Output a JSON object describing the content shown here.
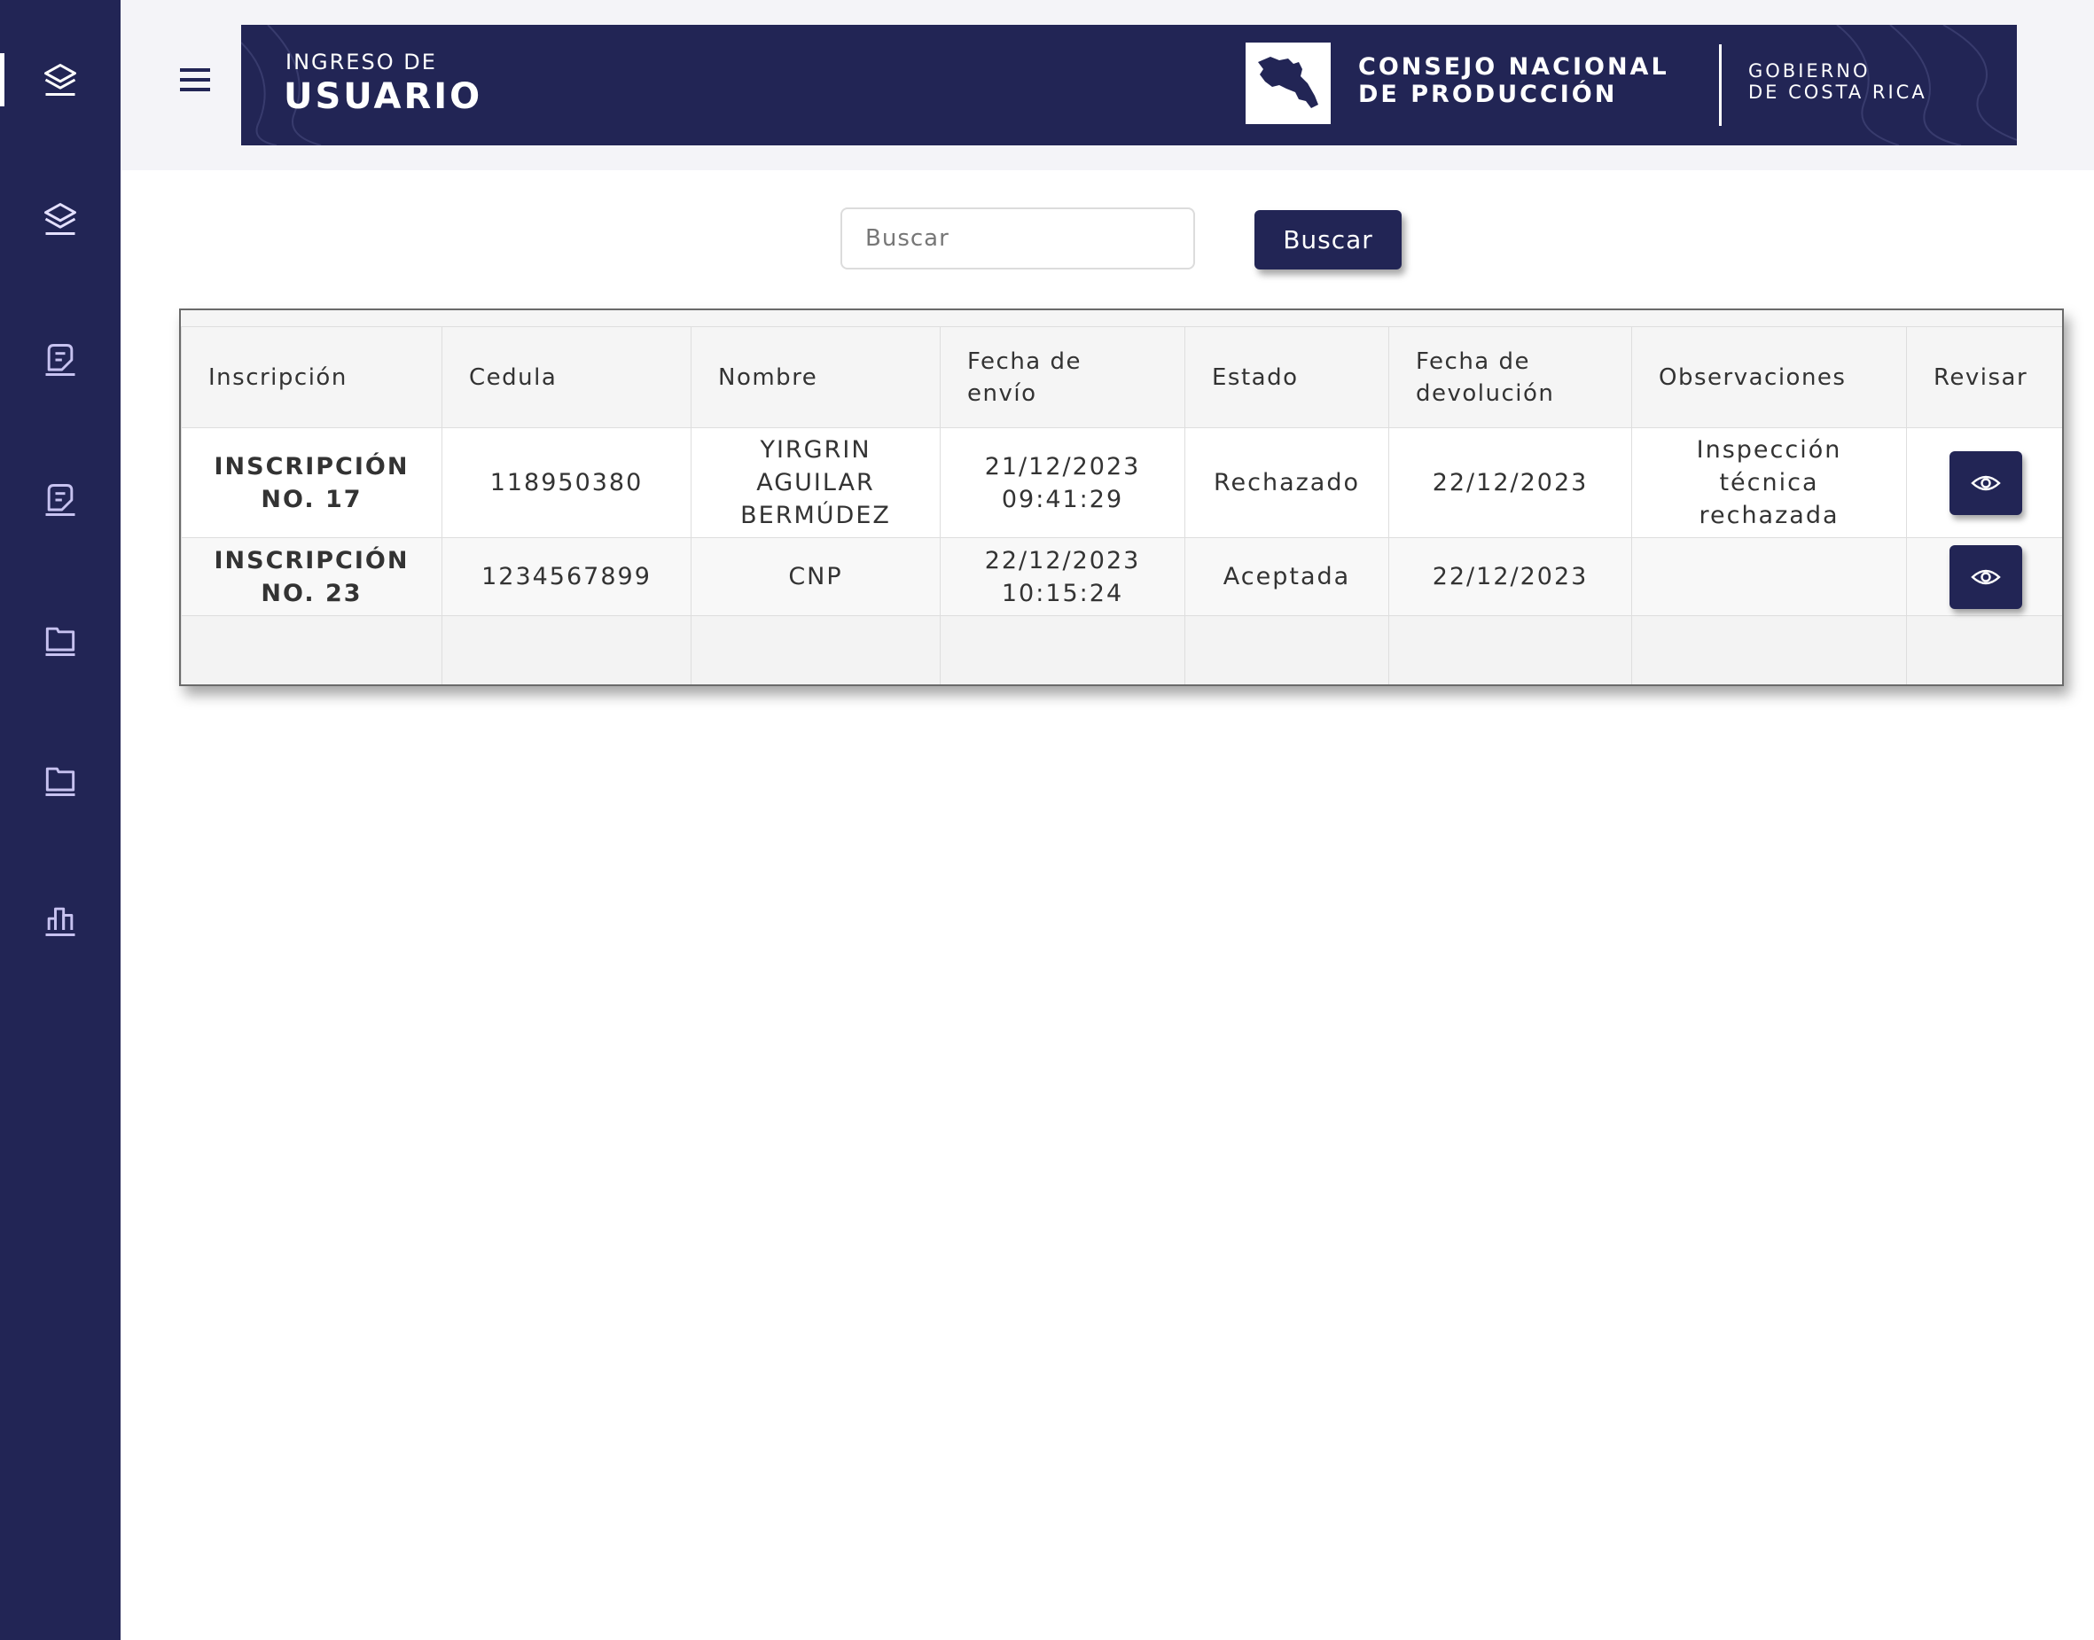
{
  "banner": {
    "subtitle": "INGRESO DE",
    "title": "USUARIO",
    "org_line1": "CONSEJO NACIONAL",
    "org_line2": "DE PRODUCCIÓN",
    "gov_line1": "GOBIERNO",
    "gov_line2": "DE COSTA RICA"
  },
  "sidebar": {
    "items": [
      {
        "icon": "layers-icon",
        "active": true
      },
      {
        "icon": "layers-icon",
        "active": false
      },
      {
        "icon": "document-icon",
        "active": false
      },
      {
        "icon": "document-icon",
        "active": false
      },
      {
        "icon": "folder-icon",
        "active": false
      },
      {
        "icon": "folder-icon",
        "active": false
      },
      {
        "icon": "bar-chart-icon",
        "active": false
      }
    ]
  },
  "search": {
    "placeholder": "Buscar",
    "value": "",
    "button_label": "Buscar"
  },
  "table": {
    "headers": {
      "inscripcion": "Inscripción",
      "cedula": "Cedula",
      "nombre": "Nombre",
      "fecha_envio_1": "Fecha de",
      "fecha_envio_2": "envío",
      "estado": "Estado",
      "fecha_dev_1": "Fecha de",
      "fecha_dev_2": "devolución",
      "observaciones": "Observaciones",
      "revisar": "Revisar"
    },
    "rows": [
      {
        "inscripcion_1": "INSCRIPCIÓN",
        "inscripcion_2": "NO. 17",
        "cedula": "118950380",
        "nombre_1": "YIRGRIN",
        "nombre_2": "AGUILAR",
        "nombre_3": "BERMÚDEZ",
        "fecha_envio_1": "21/12/2023",
        "fecha_envio_2": "09:41:29",
        "estado": "Rechazado",
        "fecha_devolucion": "22/12/2023",
        "observaciones_1": "Inspección",
        "observaciones_2": "técnica",
        "observaciones_3": "rechazada"
      },
      {
        "inscripcion_1": "INSCRIPCIÓN",
        "inscripcion_2": "NO. 23",
        "cedula": "1234567899",
        "nombre_1": "CNP",
        "fecha_envio_1": "22/12/2023",
        "fecha_envio_2": "10:15:24",
        "estado": "Aceptada",
        "fecha_devolucion": "22/12/2023",
        "observaciones_1": ""
      }
    ]
  },
  "colors": {
    "primary": "#222555",
    "sidebar_icon": "#ffffff",
    "sidebar_icon_muted": "#c7c2f0",
    "topbar_bg": "#f4f4f8"
  }
}
